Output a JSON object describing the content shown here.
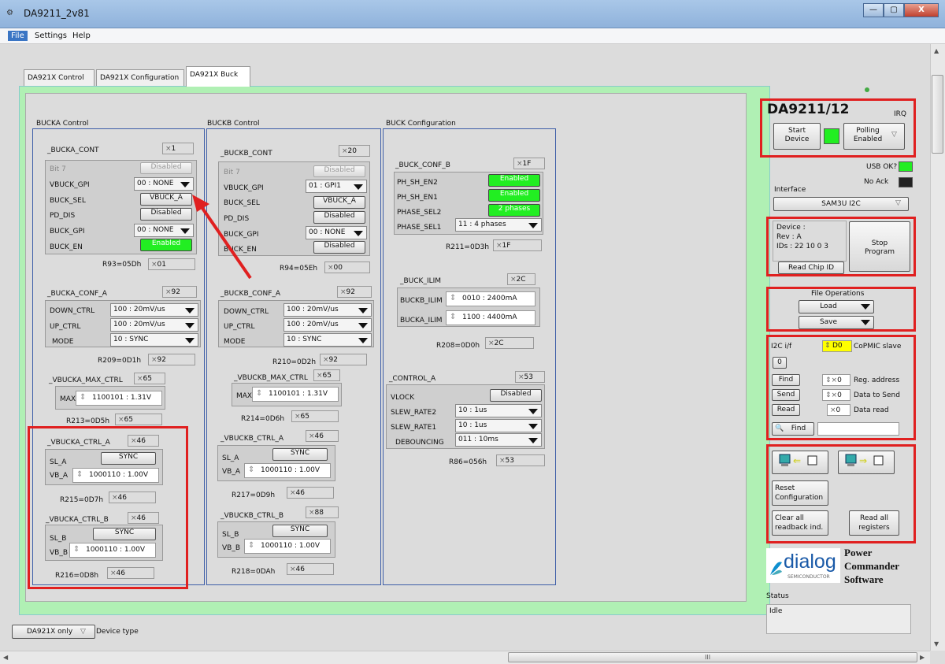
{
  "window": {
    "title": "DA9211_2v81",
    "min": "—",
    "max": "▢",
    "close": "X"
  },
  "menu": [
    "File",
    "Settings",
    "Help"
  ],
  "tabs": [
    "DA921X Control",
    "DA921X Configuration",
    "DA921X Buck"
  ],
  "bucka": {
    "title": "BUCKA Control",
    "cont": {
      "name": "_BUCKA_CONT",
      "hex": "1",
      "rows": [
        {
          "label": "Bit 7",
          "value": "Disabled"
        },
        {
          "label": "VBUCK_GPI",
          "value": "00 : NONE"
        },
        {
          "label": "BUCK_SEL",
          "value": "VBUCK_A"
        },
        {
          "label": "PD_DIS",
          "value": "Disabled"
        },
        {
          "label": "BUCK_GPI",
          "value": "00 : NONE"
        },
        {
          "label": "BUCK_EN",
          "value": "Enabled"
        }
      ],
      "reg": "R93=05Dh",
      "regval": "01"
    },
    "conf": {
      "name": "_BUCKA_CONF_A",
      "hex": "92",
      "rows": [
        {
          "label": "DOWN_CTRL",
          "value": "100 : 20mV/us"
        },
        {
          "label": "UP_CTRL",
          "value": "100 : 20mV/us"
        },
        {
          "label": "MODE",
          "value": "10 : SYNC"
        }
      ],
      "reg": "R209=0D1h",
      "regval": "92"
    },
    "max": {
      "name": "_VBUCKA_MAX_CTRL",
      "hex": "65",
      "label": "MAX",
      "value": "1100101 : 1.31V",
      "reg": "R213=0D5h",
      "regval": "65"
    },
    "ctrla": {
      "name": "_VBUCKA_CTRL_A",
      "hex": "46",
      "sl": "SL_A",
      "slval": "SYNC",
      "vb": "VB_A",
      "vbval": "1000110 : 1.00V",
      "reg": "R215=0D7h",
      "regval": "46"
    },
    "ctrlb": {
      "name": "_VBUCKA_CTRL_B",
      "hex": "46",
      "sl": "SL_B",
      "slval": "SYNC",
      "vb": "VB_B",
      "vbval": "1000110 : 1.00V",
      "reg": "R216=0D8h",
      "regval": "46"
    }
  },
  "buckb": {
    "title": "BUCKB Control",
    "cont": {
      "name": "_BUCKB_CONT",
      "hex": "20",
      "rows": [
        {
          "label": "Bit 7",
          "value": "Disabled"
        },
        {
          "label": "VBUCK_GPI",
          "value": "01 : GPI1"
        },
        {
          "label": "BUCK_SEL",
          "value": "VBUCK_A"
        },
        {
          "label": "PD_DIS",
          "value": "Disabled"
        },
        {
          "label": "BUCK_GPI",
          "value": "00 : NONE"
        },
        {
          "label": "BUCK_EN",
          "value": "Disabled"
        }
      ],
      "reg": "R94=05Eh",
      "regval": "00"
    },
    "conf": {
      "name": "_BUCKB_CONF_A",
      "hex": "92",
      "rows": [
        {
          "label": "DOWN_CTRL",
          "value": "100 : 20mV/us"
        },
        {
          "label": "UP_CTRL",
          "value": "100 : 20mV/us"
        },
        {
          "label": "MODE",
          "value": "10 : SYNC"
        }
      ],
      "reg": "R210=0D2h",
      "regval": "92"
    },
    "max": {
      "name": "_VBUCKB_MAX_CTRL",
      "hex": "65",
      "label": "MAX",
      "value": "1100101 : 1.31V",
      "reg": "R214=0D6h",
      "regval": "65"
    },
    "ctrla": {
      "name": "_VBUCKB_CTRL_A",
      "hex": "46",
      "sl": "SL_A",
      "slval": "SYNC",
      "vb": "VB_A",
      "vbval": "1000110 : 1.00V",
      "reg": "R217=0D9h",
      "regval": "46"
    },
    "ctrlb": {
      "name": "_VBUCKB_CTRL_B",
      "hex": "88",
      "sl": "SL_B",
      "slval": "SYNC",
      "vb": "VB_B",
      "vbval": "1000110 : 1.00V",
      "reg": "R218=0DAh",
      "regval": "46"
    }
  },
  "bconf": {
    "title": "BUCK Configuration",
    "confb": {
      "name": "_BUCK_CONF_B",
      "hex": "1F",
      "rows": [
        {
          "label": "PH_SH_EN2",
          "value": "Enabled"
        },
        {
          "label": "PH_SH_EN1",
          "value": "Enabled"
        },
        {
          "label": "PHASE_SEL2",
          "value": "2 phases"
        },
        {
          "label": "PHASE_SEL1",
          "value": "11 : 4 phases"
        }
      ],
      "reg": "R211=0D3h",
      "regval": "1F"
    },
    "ilim": {
      "name": "_BUCK_ILIM",
      "hex": "2C",
      "rows": [
        {
          "label": "BUCKB_ILIM",
          "value": "0010 : 2400mA"
        },
        {
          "label": "BUCKA_ILIM",
          "value": "1100 : 4400mA"
        }
      ],
      "reg": "R208=0D0h",
      "regval": "2C"
    },
    "ctrl": {
      "name": "_CONTROL_A",
      "hex": "53",
      "rows": [
        {
          "label": "VLOCK",
          "value": "Disabled"
        },
        {
          "label": "SLEW_RATE2",
          "value": "10 : 1us"
        },
        {
          "label": "SLEW_RATE1",
          "value": "10 : 1us"
        },
        {
          "label": "DEBOUNCING",
          "value": "011 : 10ms"
        }
      ],
      "reg": "R86=056h",
      "regval": "53"
    }
  },
  "right": {
    "device": "DA9211/12",
    "irq": "IRQ",
    "start": "Start Device",
    "polling": "Polling Enabled",
    "usb": "USB OK?",
    "noack": "No Ack",
    "interface": "Interface",
    "iface_val": "SAM3U I2C",
    "devinfo": [
      "Device :",
      "Rev : A",
      "IDs : 22 10 0 3"
    ],
    "stop": "Stop Program",
    "readchip": "Read Chip ID",
    "fileops": "File Operations",
    "load": "Load",
    "save": "Save",
    "i2c": "I2C i/f",
    "addr": "D0",
    "comic": "CoPMIC slave",
    "zero": "0",
    "find": "Find",
    "send": "Send",
    "read": "Read",
    "regaddr_val": "0",
    "regaddr": "Reg. address",
    "datasend_val": "0",
    "datasend": "Data to Send",
    "dataread_val": "0",
    "dataread": "Data read",
    "find2": "Find",
    "reset": "Reset Configuration",
    "clear": "Clear all readback ind.",
    "readall": "Read all registers",
    "logo": "dialog",
    "logosub": "SEMICONDUCTOR",
    "pcs": [
      "Power",
      "Commander",
      "Software"
    ],
    "status": "Status",
    "statusval": "Idle"
  },
  "bottom": {
    "devtype": "DA921X only",
    "devtype_label": "Device type"
  },
  "scroll": {
    "hmark": "III"
  },
  "colors": {
    "enabled": "#22ee22",
    "highlight": "#e02020",
    "tabbg": "#b0f0b4"
  }
}
